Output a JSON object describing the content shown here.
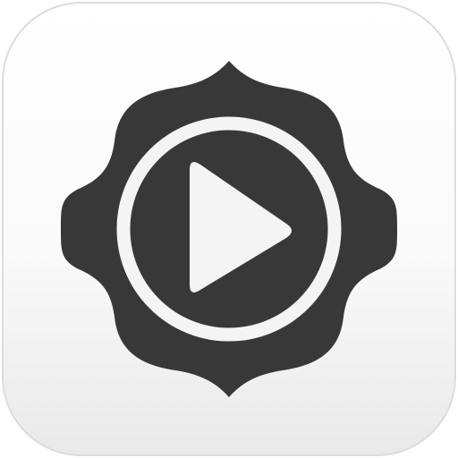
{
  "icon": {
    "name": "play-button-lotus-icon",
    "tile_colors": {
      "top": "#ffffff",
      "bottom": "#e9e9e9",
      "border": "#dcdcdc"
    },
    "emblem_color": "#383838",
    "ring_color": "#f4f4f4",
    "play_color": "#f4f4f4"
  }
}
